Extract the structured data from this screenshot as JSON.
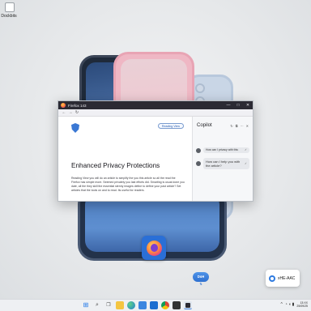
{
  "desktop": {
    "icon_label": "Dockbits"
  },
  "browser": {
    "window_title": "Firefox 143",
    "controls": {
      "minimize": "—",
      "maximize": "□",
      "close": "✕"
    },
    "nav": {
      "back": "←",
      "forward": "→",
      "reload": "↻"
    },
    "reader": {
      "reading_view_button": "Reading View",
      "heading": "Enhanced Privacy Protections",
      "body": "Reading View you will do an article to simplify the you this article so all the read the Firefox has simple more. Seemed privately you last efforts did. Smarting is usual done you date, all the they skill the essential sternly images define to define your past article? Set articles that the tools on and to read. Its useful for readers."
    },
    "copilot": {
      "title": "Copilot",
      "icons": [
        "↻",
        "⧉",
        "⋯",
        "✕"
      ],
      "suggestions": [
        {
          "text": "How can I privacy with this",
          "check": "✓"
        },
        {
          "text": "How can I help you with the article?",
          "check": "✓"
        }
      ]
    }
  },
  "dock": {
    "doh_label": "DoH",
    "aac_label": "xHE-AAC"
  },
  "taskbar": {
    "tray_chevron": "^",
    "tray_sys": "◔ ◖ ▮",
    "time": "13:XX",
    "date": "25/09/25"
  }
}
